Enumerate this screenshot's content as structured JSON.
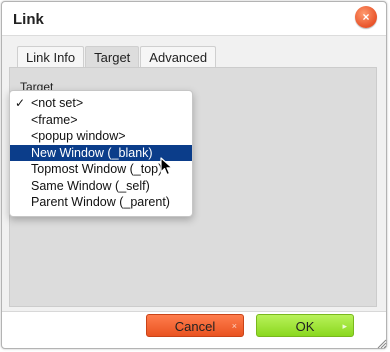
{
  "dialog": {
    "title": "Link",
    "close_symbol": "×"
  },
  "tabs": [
    {
      "label": "Link Info"
    },
    {
      "label": "Target"
    },
    {
      "label": "Advanced"
    }
  ],
  "active_tab": "Target",
  "target": {
    "label": "Target",
    "checked_option": "<not set>",
    "highlighted_option": "New Window (_blank)",
    "options": [
      {
        "label": "<not set>",
        "check": "✓"
      },
      {
        "label": "<frame>"
      },
      {
        "label": "<popup window>"
      },
      {
        "label": "New Window (_blank)"
      },
      {
        "label": "Topmost Window (_top)"
      },
      {
        "label": "Same Window (_self)"
      },
      {
        "label": "Parent Window (_parent)"
      }
    ]
  },
  "buttons": {
    "cancel": {
      "label": "Cancel",
      "icon": "×"
    },
    "ok": {
      "label": "OK",
      "icon": "▸"
    }
  },
  "colors": {
    "cancel": "#ef5b27",
    "ok": "#9be030",
    "highlight": "#0b3d8a"
  }
}
